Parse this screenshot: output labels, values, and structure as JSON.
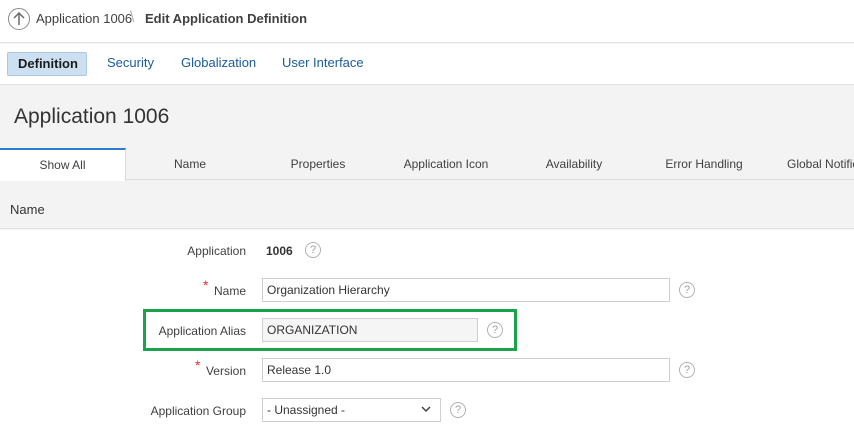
{
  "breadcrumb": {
    "app": "Application 1006",
    "separator": "\\",
    "current": "Edit Application Definition"
  },
  "top_tabs": [
    {
      "label": "Definition",
      "active": true
    },
    {
      "label": "Security",
      "active": false
    },
    {
      "label": "Globalization",
      "active": false
    },
    {
      "label": "User Interface",
      "active": false
    }
  ],
  "page": {
    "title": "Application 1006"
  },
  "region_tabs": [
    {
      "label": "Show All",
      "active": true
    },
    {
      "label": "Name",
      "active": false
    },
    {
      "label": "Properties",
      "active": false
    },
    {
      "label": "Application Icon",
      "active": false
    },
    {
      "label": "Availability",
      "active": false
    },
    {
      "label": "Error Handling",
      "active": false
    },
    {
      "label": "Global Notific",
      "active": false
    }
  ],
  "region": {
    "title": "Name"
  },
  "form": {
    "application": {
      "label": "Application",
      "value": "1006"
    },
    "name": {
      "label": "Name",
      "value": "Organization Hierarchy",
      "required_mark": "*"
    },
    "alias": {
      "label": "Application Alias",
      "value": "ORGANIZATION"
    },
    "version": {
      "label": "Version",
      "value": "Release 1.0",
      "required_mark": "*"
    },
    "group": {
      "label": "Application Group",
      "value": "- Unassigned -"
    },
    "help_glyph": "?"
  },
  "colors": {
    "accent": "#2e7bd2",
    "highlight": "#1aa34a",
    "required": "#e03030",
    "link": "#1a5b9b"
  }
}
